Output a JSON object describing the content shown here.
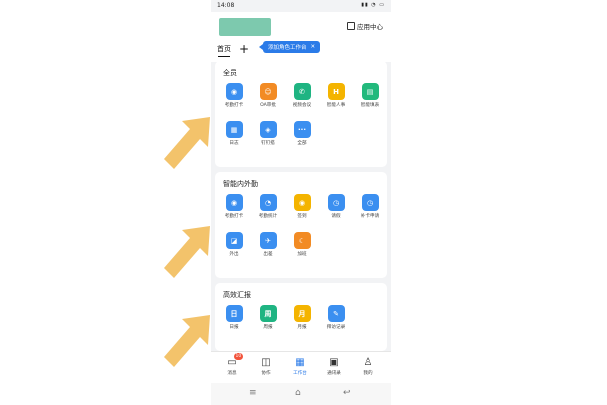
{
  "status_bar": {
    "time": "14:08"
  },
  "header": {
    "app_center_label": "应用中心"
  },
  "tabs": {
    "home_label": "首页",
    "add_label": "+"
  },
  "tooltip": {
    "text": "添加角色工作台",
    "close_label": "✕"
  },
  "sections": [
    {
      "title": "全员",
      "apps": [
        {
          "label": "考勤打卡",
          "color": "#3b8ff0",
          "icon": "location-pin-icon",
          "glyph": "◉"
        },
        {
          "label": "OA审批",
          "color": "#f28b24",
          "icon": "person-approval-icon",
          "glyph": "☺"
        },
        {
          "label": "视频会议",
          "color": "#1fb482",
          "icon": "phone-call-icon",
          "glyph": "✆"
        },
        {
          "label": "智能人事",
          "color": "#f4b400",
          "icon": "hr-icon",
          "glyph": "H"
        },
        {
          "label": "智能填表",
          "color": "#22b97c",
          "icon": "form-icon",
          "glyph": "▤"
        },
        {
          "label": "日志",
          "color": "#3b8ff0",
          "icon": "log-icon",
          "glyph": "▦"
        },
        {
          "label": "钉钉搭",
          "color": "#3b8ff0",
          "icon": "builder-icon",
          "glyph": "◈"
        },
        {
          "label": "全部",
          "color": "#3b8ff0",
          "icon": "more-icon",
          "glyph": "···"
        }
      ]
    },
    {
      "title": "智能内外勤",
      "apps": [
        {
          "label": "考勤打卡",
          "color": "#3b8ff0",
          "icon": "location-pin-icon",
          "glyph": "◉"
        },
        {
          "label": "考勤统计",
          "color": "#3b8ff0",
          "icon": "stats-icon",
          "glyph": "◔"
        },
        {
          "label": "签到",
          "color": "#f4b400",
          "icon": "checkin-icon",
          "glyph": "◉"
        },
        {
          "label": "请假",
          "color": "#3b8ff0",
          "icon": "clock-icon",
          "glyph": "◷"
        },
        {
          "label": "补卡申请",
          "color": "#3b8ff0",
          "icon": "clock-icon",
          "glyph": "◷"
        },
        {
          "label": "外出",
          "color": "#3b8ff0",
          "icon": "outing-icon",
          "glyph": "◪"
        },
        {
          "label": "出差",
          "color": "#3b8ff0",
          "icon": "plane-icon",
          "glyph": "✈"
        },
        {
          "label": "加班",
          "color": "#f28b24",
          "icon": "overtime-icon",
          "glyph": "☾"
        }
      ]
    },
    {
      "title": "高效汇报",
      "apps": [
        {
          "label": "日报",
          "color": "#3b8ff0",
          "icon": "daily-report-icon",
          "glyph": "日"
        },
        {
          "label": "周报",
          "color": "#1fb482",
          "icon": "weekly-report-icon",
          "glyph": "周"
        },
        {
          "label": "月报",
          "color": "#f4b400",
          "icon": "monthly-report-icon",
          "glyph": "月"
        },
        {
          "label": "拜访记录",
          "color": "#3b8ff0",
          "icon": "visit-record-icon",
          "glyph": "✎"
        }
      ]
    }
  ],
  "bottom_nav": [
    {
      "label": "消息",
      "icon": "chat-icon",
      "badge": "10"
    },
    {
      "label": "协作",
      "icon": "collab-icon"
    },
    {
      "label": "工作台",
      "icon": "workbench-icon",
      "active": true
    },
    {
      "label": "通讯录",
      "icon": "contacts-icon"
    },
    {
      "label": "我的",
      "icon": "profile-icon"
    }
  ],
  "colors": {
    "accent": "#2b7be8",
    "arrow": "#f3c36b",
    "brand_block": "#7dc9ae"
  }
}
